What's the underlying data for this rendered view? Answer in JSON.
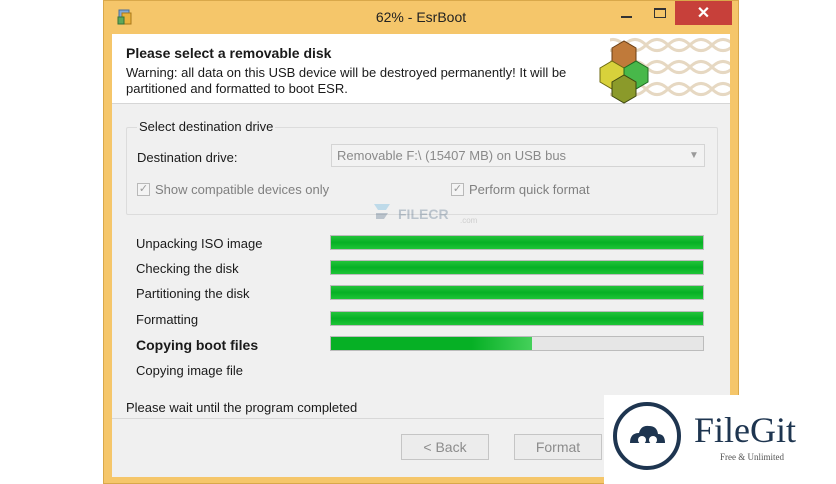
{
  "window": {
    "title": "62% - EsrBoot",
    "close_glyph": "✕"
  },
  "header": {
    "title": "Please select a removable disk",
    "text": "Warning: all data on this USB device will be destroyed permanently! It will be partitioned and formatted to boot ESR."
  },
  "destination": {
    "group_label": "Select destination drive",
    "drive_label": "Destination drive:",
    "drive_value": "Removable  F:\\  (15407 MB)  on USB bus",
    "show_compatible_label": "Show compatible devices only",
    "show_compatible_checked": true,
    "quick_format_label": "Perform quick format",
    "quick_format_checked": true
  },
  "watermark": {
    "text": "FILECR",
    "sub": ".com"
  },
  "tasks": [
    {
      "label": "Unpacking ISO image",
      "progress": 1.0,
      "active": false
    },
    {
      "label": "Checking the disk",
      "progress": 1.0,
      "active": false
    },
    {
      "label": "Partitioning the disk",
      "progress": 1.0,
      "active": false
    },
    {
      "label": "Formatting",
      "progress": 1.0,
      "active": false
    },
    {
      "label": "Copying boot files",
      "progress": 0.54,
      "active": true
    },
    {
      "label": "Copying image file",
      "progress": null,
      "active": false
    }
  ],
  "status_text": "Please wait until the program completed",
  "buttons": {
    "back": "< Back",
    "format": "Format"
  },
  "badge": {
    "name": "FileGit",
    "tagline": "Free & Unlimited"
  },
  "colors": {
    "progress_green": "#06b025",
    "title_bar": "#f5c66a",
    "close_button": "#c7403a"
  }
}
